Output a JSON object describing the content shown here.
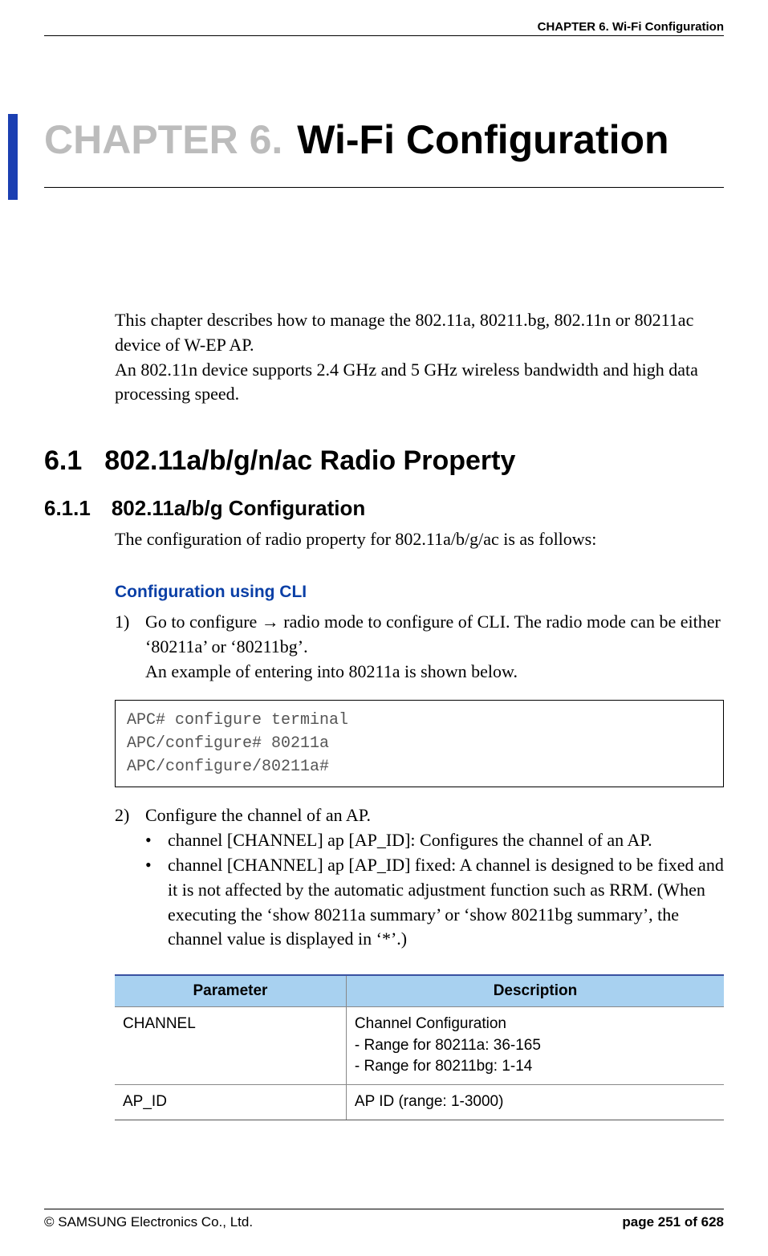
{
  "header": {
    "right": "CHAPTER 6. Wi-Fi Configuration"
  },
  "chapter": {
    "label": "CHAPTER 6.",
    "title": "Wi-Fi Configuration"
  },
  "intro": {
    "p1": "This chapter describes how to manage the 802.11a, 80211.bg, 802.11n or 80211ac device of W-EP AP.",
    "p2": "An 802.11n device supports 2.4 GHz and 5 GHz wireless bandwidth and high data processing speed."
  },
  "s61": {
    "num": "6.1",
    "title": "802.11a/b/g/n/ac Radio Property"
  },
  "s611": {
    "num": "6.1.1",
    "title": "802.11a/b/g Configuration",
    "intro": "The configuration of radio property for 802.11a/b/g/ac is as follows:"
  },
  "cli": {
    "heading": "Configuration using CLI",
    "step1_num": "1)",
    "step1_a": "Go to configure → radio mode to configure of CLI. The radio mode can be either ‘80211a’ or ‘80211bg’.",
    "step1_b": "An example of entering into 80211a is shown below.",
    "code": "APC# configure terminal\nAPC/configure# 80211a\nAPC/configure/80211a#",
    "step2_num": "2)",
    "step2": "Configure the channel of an AP.",
    "bullet_dot": "•",
    "bullet1": "channel [CHANNEL] ap [AP_ID]: Configures the channel of an AP.",
    "bullet2": "channel [CHANNEL] ap [AP_ID] fixed: A channel is designed to be fixed and it is not affected by the automatic adjustment function such as RRM. (When executing the ‘show 80211a summary’ or ‘show 80211bg summary’, the channel value is displayed in ‘*’.)"
  },
  "table": {
    "col1_header": "Parameter",
    "col2_header": "Description",
    "rows": [
      {
        "param": "CHANNEL",
        "desc": "Channel Configuration\n- Range for 80211a: 36-165\n- Range for 80211bg: 1-14"
      },
      {
        "param": "AP_ID",
        "desc": "AP ID (range: 1-3000)"
      }
    ]
  },
  "footer": {
    "left": "© SAMSUNG Electronics Co., Ltd.",
    "right": "page 251 of 628"
  }
}
